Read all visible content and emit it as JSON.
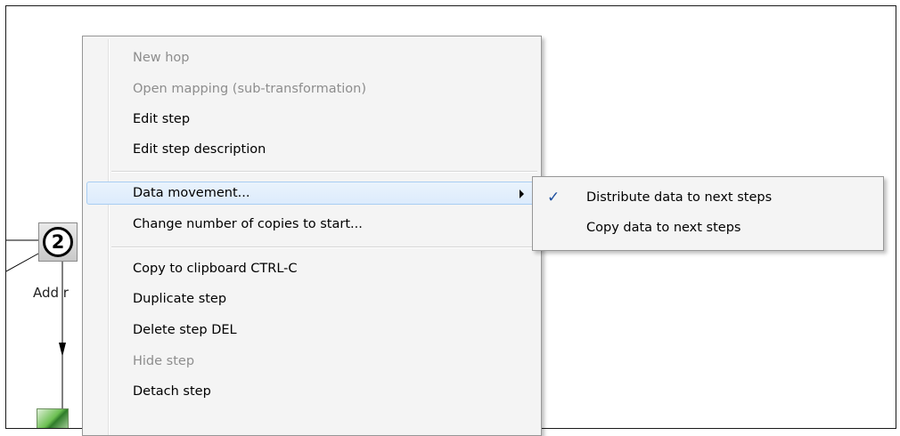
{
  "canvas": {
    "step_label": "Add r",
    "step_copies": "2"
  },
  "context_menu": {
    "items": [
      {
        "label": "New hop",
        "enabled": false
      },
      {
        "label": "Open mapping (sub-transformation)",
        "enabled": false
      },
      {
        "label": "Edit step",
        "enabled": true
      },
      {
        "label": "Edit step description",
        "enabled": true
      },
      {
        "label": "Data movement...",
        "enabled": true,
        "highlighted": true,
        "has_submenu": true
      },
      {
        "label": "Change number of copies to start...",
        "enabled": true
      },
      {
        "label": "Copy to clipboard CTRL-C",
        "enabled": true
      },
      {
        "label": "Duplicate step",
        "enabled": true
      },
      {
        "label": "Delete step DEL",
        "enabled": true
      },
      {
        "label": "Hide step",
        "enabled": false
      },
      {
        "label": "Detach step",
        "enabled": true
      }
    ]
  },
  "submenu": {
    "items": [
      {
        "label": "Distribute data to next steps",
        "checked": true,
        "check_icon": "checkmark-icon"
      },
      {
        "label": "Copy data to next steps",
        "checked": false
      }
    ]
  },
  "colors": {
    "menu_background": "#f4f4f4",
    "highlight_border": "#a8cdf2",
    "disabled_text": "#8d8d8d",
    "check_color": "#1d4f9e"
  }
}
